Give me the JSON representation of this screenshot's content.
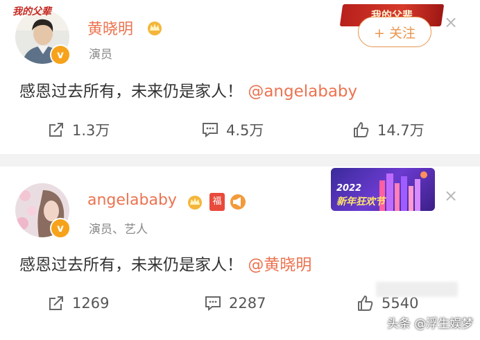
{
  "post1": {
    "logo_text": "我的父辈",
    "username": "黄晓明",
    "subtitle": "演员",
    "text": "感恩过去所有，未来仍是家人！",
    "mention": "@angelababy",
    "banner_text": "我的父辈",
    "follow_label": "+ 关注",
    "close_label": "×",
    "actions": {
      "repost": "1.3万",
      "comment": "4.5万",
      "like": "14.7万"
    }
  },
  "post2": {
    "username": "angelababy",
    "subtitle": "演员、艺人",
    "text": "感恩过去所有，未来仍是家人！",
    "mention": "@黄晓明",
    "fu_badge": "福",
    "banner_year": "2022",
    "banner_text": "新年狂欢节",
    "close_label": "×",
    "actions": {
      "repost": "1269",
      "comment": "2287",
      "like": "5540"
    }
  },
  "watermark": "头条 @浮生娱梦",
  "colors": {
    "accent": "#eb7350",
    "verified": "#f7a21b",
    "separator": "#f2f2f2"
  }
}
